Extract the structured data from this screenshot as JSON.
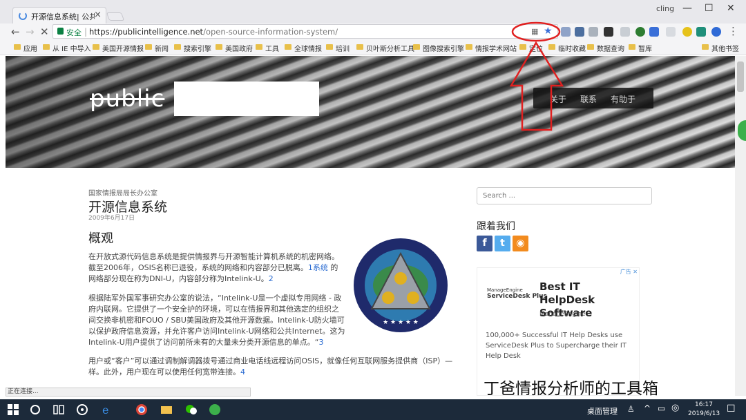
{
  "browser": {
    "tab_title": "开源信息系统| 公共情报",
    "tab_close": "×",
    "user": "cling",
    "window_controls": [
      "—",
      "☐",
      "✕"
    ],
    "secure_label": "安全",
    "url_host": "https://publicintelligence.net",
    "url_path": "/open-source-information-system/"
  },
  "bookmarks": [
    {
      "label": "应用"
    },
    {
      "label": "从 IE 中导入"
    },
    {
      "label": "美国开源情报"
    },
    {
      "label": "新闻"
    },
    {
      "label": "搜索引擎"
    },
    {
      "label": "美国政府"
    },
    {
      "label": "工具"
    },
    {
      "label": "全球情报"
    },
    {
      "label": "培训"
    },
    {
      "label": "贝叶斯分析工具"
    },
    {
      "label": "图像搜索引擎"
    },
    {
      "label": "情报学术网站"
    },
    {
      "label": "定位"
    },
    {
      "label": "临时收藏"
    },
    {
      "label": "数据查询"
    },
    {
      "label": "暂库"
    },
    {
      "label": "其他书签"
    }
  ],
  "site": {
    "logo": "public",
    "nav": [
      "关于",
      "联系",
      "有助于"
    ]
  },
  "article": {
    "breadcrumb": "国家情报局局长办公室",
    "title": "开源信息系统",
    "date": "2009年6月17日",
    "section": "概观",
    "p1_l1": "在开放式源代码信息系统是提供情报界与开源智能计算机系统的机密网络。",
    "p1_l2": "截至2006年，OSIS名称已退役，系统的网络和内容部分已脱离。",
    "p1_link": "1系统",
    "p1_l2b": " 的",
    "p1_l3": "网络部分现在称为DNI-U，内容部分称为Intelink-U。",
    "p1_ref": "2",
    "p2_l1": "根据陆军外国军事研究办公室的说法，“Intelink-U是一个虚拟专用网络 - 政",
    "p2_l2": "府内联网。它提供了一个安全护的环境，可以在情报界和其他选定的组织之",
    "p2_l3": "间交换非机密和FOUO / SBU美国政府及其他开源数据。Intelink-U防火墙可",
    "p2_l4": "以保护政府信息资源，并允许客户访问Intelink-U网络和公共Internet。这为",
    "p2_l5": "Intelink-U用户提供了访问前所未有的大量未分类开源信息的单点。“",
    "p2_ref": "3",
    "p3_l1": "用户或“客户”可以通过调制解调器拨号通过商业电话线远程访问OSIS，就像任何互联网服务提供商（ISP）—",
    "p3_l2": "样。此外，用户现在可以使用任何宽带连接。",
    "p3_ref": "4"
  },
  "sidebar": {
    "search_placeholder": "Search ...",
    "follow_title": "跟着我们",
    "social": [
      {
        "glyph": "f",
        "color": "#3b5998"
      },
      {
        "glyph": "t",
        "color": "#55acee"
      },
      {
        "glyph": "◉",
        "color": "#f28b1e"
      }
    ],
    "ad": {
      "tag": "广告 ✕",
      "brand_top": "ManageEngine",
      "brand_name": "ServiceDesk Plus",
      "headline": "Best IT HelpDesk Software",
      "sub": "ManageEngine",
      "body": "100,000+ Successful IT Help Desks use ServiceDesk Plus to Supercharge their IT Help Desk"
    }
  },
  "status_text": "正在连接...",
  "watermark": "丁爸情报分析师的工具箱",
  "taskbar": {
    "label": "桌面管理",
    "time": "16:17",
    "date": "2019/6/13"
  },
  "colors": {
    "annotation_red": "#e02020",
    "link": "#2a6bd1",
    "taskbar": "#1c2a3a"
  }
}
